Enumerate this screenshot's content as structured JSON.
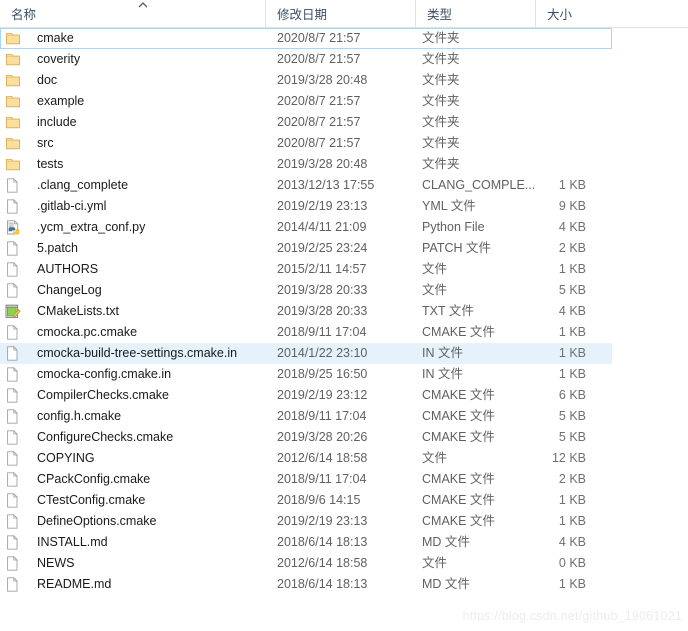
{
  "header": {
    "columns": [
      {
        "id": "name",
        "label": "名称",
        "sort": "asc"
      },
      {
        "id": "date",
        "label": "修改日期",
        "sort": "none"
      },
      {
        "id": "type",
        "label": "类型",
        "sort": "none"
      },
      {
        "id": "size",
        "label": "大小",
        "sort": "none"
      }
    ]
  },
  "rows": [
    {
      "name": "cmake",
      "date": "2020/8/7 21:57",
      "type": "文件夹",
      "size": "",
      "icon": "folder-icon",
      "state": "focused"
    },
    {
      "name": "coverity",
      "date": "2020/8/7 21:57",
      "type": "文件夹",
      "size": "",
      "icon": "folder-icon",
      "state": "normal"
    },
    {
      "name": "doc",
      "date": "2019/3/28 20:48",
      "type": "文件夹",
      "size": "",
      "icon": "folder-icon",
      "state": "normal"
    },
    {
      "name": "example",
      "date": "2020/8/7 21:57",
      "type": "文件夹",
      "size": "",
      "icon": "folder-icon",
      "state": "normal"
    },
    {
      "name": "include",
      "date": "2020/8/7 21:57",
      "type": "文件夹",
      "size": "",
      "icon": "folder-icon",
      "state": "normal"
    },
    {
      "name": "src",
      "date": "2020/8/7 21:57",
      "type": "文件夹",
      "size": "",
      "icon": "folder-icon",
      "state": "normal"
    },
    {
      "name": "tests",
      "date": "2019/3/28 20:48",
      "type": "文件夹",
      "size": "",
      "icon": "folder-icon",
      "state": "normal"
    },
    {
      "name": ".clang_complete",
      "date": "2013/12/13 17:55",
      "type": "CLANG_COMPLE...",
      "size": "1 KB",
      "icon": "generic-file-icon",
      "state": "normal"
    },
    {
      "name": ".gitlab-ci.yml",
      "date": "2019/2/19 23:13",
      "type": "YML 文件",
      "size": "9 KB",
      "icon": "generic-file-icon",
      "state": "normal"
    },
    {
      "name": ".ycm_extra_conf.py",
      "date": "2014/4/11 21:09",
      "type": "Python File",
      "size": "4 KB",
      "icon": "python-file-icon",
      "state": "normal"
    },
    {
      "name": "5.patch",
      "date": "2019/2/25 23:24",
      "type": "PATCH 文件",
      "size": "2 KB",
      "icon": "generic-file-icon",
      "state": "normal"
    },
    {
      "name": "AUTHORS",
      "date": "2015/2/11 14:57",
      "type": "文件",
      "size": "1 KB",
      "icon": "generic-file-icon",
      "state": "normal"
    },
    {
      "name": "ChangeLog",
      "date": "2019/3/28 20:33",
      "type": "文件",
      "size": "5 KB",
      "icon": "generic-file-icon",
      "state": "normal"
    },
    {
      "name": "CMakeLists.txt",
      "date": "2019/3/28 20:33",
      "type": "TXT 文件",
      "size": "4 KB",
      "icon": "notepad-file-icon",
      "state": "normal"
    },
    {
      "name": "cmocka.pc.cmake",
      "date": "2018/9/11 17:04",
      "type": "CMAKE 文件",
      "size": "1 KB",
      "icon": "generic-file-icon",
      "state": "normal"
    },
    {
      "name": "cmocka-build-tree-settings.cmake.in",
      "date": "2014/1/22 23:10",
      "type": "IN 文件",
      "size": "1 KB",
      "icon": "generic-file-icon",
      "state": "highlighted"
    },
    {
      "name": "cmocka-config.cmake.in",
      "date": "2018/9/25 16:50",
      "type": "IN 文件",
      "size": "1 KB",
      "icon": "generic-file-icon",
      "state": "normal"
    },
    {
      "name": "CompilerChecks.cmake",
      "date": "2019/2/19 23:12",
      "type": "CMAKE 文件",
      "size": "6 KB",
      "icon": "generic-file-icon",
      "state": "normal"
    },
    {
      "name": "config.h.cmake",
      "date": "2018/9/11 17:04",
      "type": "CMAKE 文件",
      "size": "5 KB",
      "icon": "generic-file-icon",
      "state": "normal"
    },
    {
      "name": "ConfigureChecks.cmake",
      "date": "2019/3/28 20:26",
      "type": "CMAKE 文件",
      "size": "5 KB",
      "icon": "generic-file-icon",
      "state": "normal"
    },
    {
      "name": "COPYING",
      "date": "2012/6/14 18:58",
      "type": "文件",
      "size": "12 KB",
      "icon": "generic-file-icon",
      "state": "normal"
    },
    {
      "name": "CPackConfig.cmake",
      "date": "2018/9/11 17:04",
      "type": "CMAKE 文件",
      "size": "2 KB",
      "icon": "generic-file-icon",
      "state": "normal"
    },
    {
      "name": "CTestConfig.cmake",
      "date": "2018/9/6 14:15",
      "type": "CMAKE 文件",
      "size": "1 KB",
      "icon": "generic-file-icon",
      "state": "normal"
    },
    {
      "name": "DefineOptions.cmake",
      "date": "2019/2/19 23:13",
      "type": "CMAKE 文件",
      "size": "1 KB",
      "icon": "generic-file-icon",
      "state": "normal"
    },
    {
      "name": "INSTALL.md",
      "date": "2018/6/14 18:13",
      "type": "MD 文件",
      "size": "4 KB",
      "icon": "generic-file-icon",
      "state": "normal"
    },
    {
      "name": "NEWS",
      "date": "2012/6/14 18:58",
      "type": "文件",
      "size": "0 KB",
      "icon": "generic-file-icon",
      "state": "normal"
    },
    {
      "name": "README.md",
      "date": "2018/6/14 18:13",
      "type": "MD 文件",
      "size": "1 KB",
      "icon": "generic-file-icon",
      "state": "normal"
    }
  ],
  "watermark": {
    "text": "https://blog.csdn.net/github_19061021"
  },
  "colors": {
    "focus_border": "#a6d8f5",
    "highlight_bg": "#e5f1fb",
    "header_text": "#3b4f66",
    "folder_fill": "#fcdf9e",
    "folder_stroke": "#dcb35e"
  }
}
